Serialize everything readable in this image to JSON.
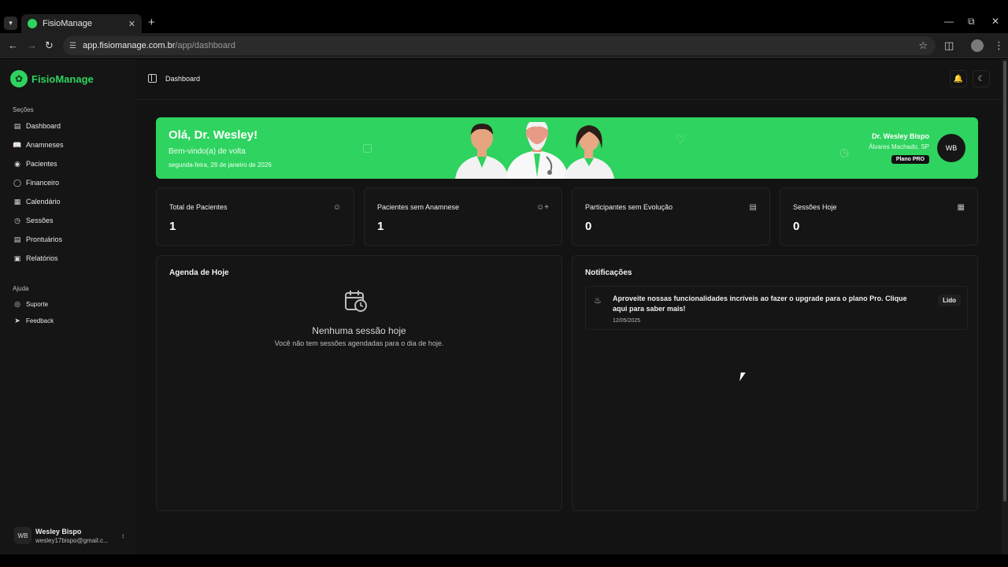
{
  "browser": {
    "tab_title": "FisioManage",
    "url_host": "app.fisiomanage.com.br",
    "url_path": "/app/dashboard"
  },
  "sidebar": {
    "app_name": "FisioManage",
    "section_sections": "Seções",
    "items": [
      {
        "label": "Dashboard",
        "icon": "dashboard-icon"
      },
      {
        "label": "Anamneses",
        "icon": "book-icon"
      },
      {
        "label": "Pacientes",
        "icon": "users-icon"
      },
      {
        "label": "Financeiro",
        "icon": "money-icon"
      },
      {
        "label": "Calendário",
        "icon": "calendar-icon"
      },
      {
        "label": "Sessões",
        "icon": "calendar-clock-icon"
      },
      {
        "label": "Prontuários",
        "icon": "document-icon"
      },
      {
        "label": "Relatórios",
        "icon": "report-icon"
      }
    ],
    "section_help": "Ajuda",
    "help_items": [
      {
        "label": "Suporte",
        "icon": "lifebuoy-icon"
      },
      {
        "label": "Feedback",
        "icon": "send-icon"
      }
    ],
    "user": {
      "initials": "WB",
      "name": "Wesley Bispo",
      "email": "wesley17bispo@gmail.c..."
    }
  },
  "header": {
    "breadcrumb": "Dashboard"
  },
  "banner": {
    "greeting": "Olá, Dr. Wesley!",
    "welcome": "Bem-vindo(a) de volta",
    "date": "segunda-feira, 26 de janeiro de 2026",
    "doctor_name": "Dr. Wesley Bispo",
    "location": "Álvares Machado, SP",
    "plan": "Plano PRO",
    "initials": "WB",
    "color": "#2fd35f"
  },
  "stats": [
    {
      "label": "Total de Pacientes",
      "value": "1",
      "icon": "users-icon"
    },
    {
      "label": "Pacientes sem Anamnese",
      "value": "1",
      "icon": "user-plus-icon"
    },
    {
      "label": "Participantes sem Evolução",
      "value": "0",
      "icon": "file-icon"
    },
    {
      "label": "Sessões Hoje",
      "value": "0",
      "icon": "calendar-icon"
    }
  ],
  "agenda": {
    "title": "Agenda de Hoje",
    "empty_title": "Nenhuma sessão hoje",
    "empty_text": "Você não tem sessões agendadas para o dia de hoje."
  },
  "notifications": {
    "title": "Notificações",
    "items": [
      {
        "message": "Aproveite nossas funcionalidades incríveis ao fazer o upgrade para o plano Pro. Clique aqui para saber mais!",
        "date": "12/05/2025",
        "action": "Lido"
      }
    ]
  }
}
